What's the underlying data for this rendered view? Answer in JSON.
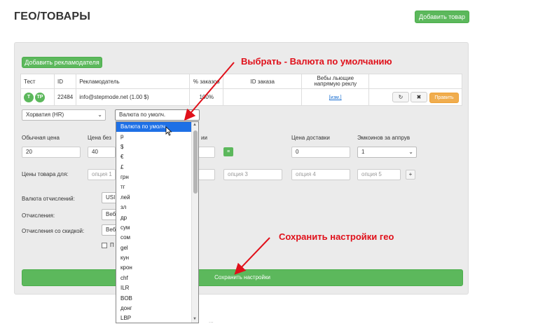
{
  "header": {
    "title": "ГЕО/ТОВАРЫ",
    "add_product_label": "Добавить товар"
  },
  "panel": {
    "add_advertiser_label": "Добавить рекламодателя",
    "table": {
      "columns": [
        "Тест",
        "ID",
        "Рекламодатель",
        "% заказов",
        "ID заказа",
        "Вебы льющие напрямую реклу",
        ""
      ],
      "row": {
        "test_badges": [
          "T",
          "TP"
        ],
        "id": "22484",
        "advertiser": "info@stepmode.net (1.00 $)",
        "percent": "100%",
        "order_id": "",
        "webs_link": "[изм.]",
        "edit_label": "Править"
      }
    },
    "country_select": "Хорватия (HR)",
    "currency_select": "Валюта по умолч.",
    "labels": {
      "normal_price": "Обычная цена",
      "price_without": "Цена без",
      "price_suffix": "ии",
      "delivery_price": "Цена доставки",
      "emoji_approve": "Эмкоинов за аппрув",
      "product_prices": "Цены товара для:",
      "payout_currency": "Валюта отчислений:",
      "payouts": "Отчисления:",
      "payouts_discount": "Отчисления со скидкой:",
      "checkbox_label": "П"
    },
    "values": {
      "normal_price": "20",
      "price_without": "40",
      "delivery_price": "0",
      "emoji_approve": "1",
      "payout_currency": "USI",
      "payouts": "Веб",
      "payouts_discount": "Веб"
    },
    "option_placeholders": [
      "опция 1",
      "опция 3",
      "опция 4",
      "опция 5"
    ],
    "save_label": "Сохранить настройки"
  },
  "dropdown": {
    "items": [
      "Валюта по умолч.",
      "р",
      "$",
      "€",
      "£",
      "грн",
      "тг",
      "лей",
      "зл",
      "др",
      "сум",
      "сом",
      "gel",
      "кун",
      "крон",
      "chf",
      "ILR",
      "BOB",
      "донг",
      "LBP"
    ],
    "selected_index": 0
  },
  "annotations": {
    "top": "Выбрать - Валюта по умолчанию",
    "bottom": "Сохранить настройки гео"
  },
  "footer": {
    "partial_text": "..."
  },
  "colors": {
    "green": "#5cb85c",
    "orange": "#f0ad4e",
    "annotation_red": "#e0101a",
    "selected_blue": "#1e70e6"
  }
}
